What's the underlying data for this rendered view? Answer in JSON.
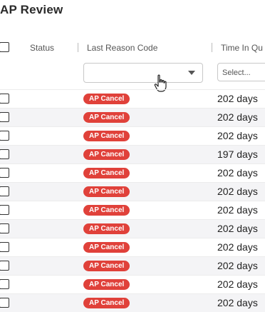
{
  "page": {
    "title": "AP Review"
  },
  "table": {
    "columns": {
      "status": "Status",
      "last_reason_code": "Last Reason Code",
      "time_in_queue": "Time In Qu"
    },
    "filters": {
      "reason_code_value": "",
      "time_placeholder": "Select..."
    },
    "rows": [
      {
        "reason": "AP Cancel",
        "time": "202 days"
      },
      {
        "reason": "AP Cancel",
        "time": "202 days"
      },
      {
        "reason": "AP Cancel",
        "time": "202 days"
      },
      {
        "reason": "AP Cancel",
        "time": "197 days"
      },
      {
        "reason": "AP Cancel",
        "time": "202 days"
      },
      {
        "reason": "AP Cancel",
        "time": "202 days"
      },
      {
        "reason": "AP Cancel",
        "time": "202 days"
      },
      {
        "reason": "AP Cancel",
        "time": "202 days"
      },
      {
        "reason": "AP Cancel",
        "time": "202 days"
      },
      {
        "reason": "AP Cancel",
        "time": "202 days"
      },
      {
        "reason": "AP Cancel",
        "time": "202 days"
      },
      {
        "reason": "AP Cancel",
        "time": "202 days"
      }
    ]
  },
  "colors": {
    "badge": "#e0413a",
    "row_alt": "#f4f4f6"
  },
  "icons": {
    "cursor": "hand-pointer-icon",
    "caret": "caret-down-icon"
  }
}
